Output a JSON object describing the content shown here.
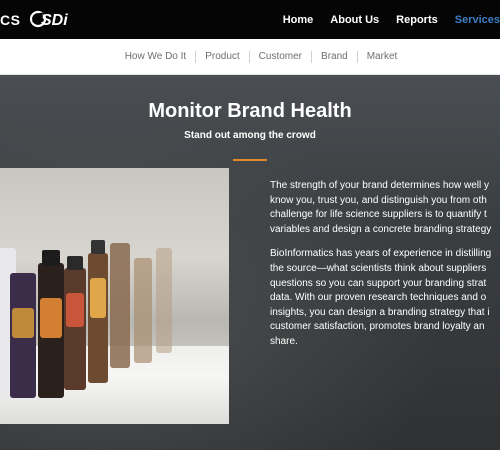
{
  "header": {
    "brand_fragment": "CS",
    "logo_text": "SDi",
    "nav": [
      {
        "label": "Home",
        "active": false
      },
      {
        "label": "About Us",
        "active": false
      },
      {
        "label": "Reports",
        "active": false
      },
      {
        "label": "Services",
        "active": true
      }
    ]
  },
  "subnav": {
    "items": [
      "How We Do It",
      "Product",
      "Customer",
      "Brand",
      "Market"
    ]
  },
  "hero": {
    "title": "Monitor Brand Health",
    "subtitle": "Stand out among the crowd",
    "accent_color": "#e0892b",
    "paragraph1_lines": [
      "The strength of your brand determines how well y",
      "know you, trust you, and distinguish you from oth",
      "challenge for life science suppliers is to quantify t",
      "variables and design a concrete branding strategy"
    ],
    "paragraph2_lines": [
      "BioInformatics has years of experience in distilling",
      "the source—what scientists think about suppliers",
      "questions so you can support your branding strat",
      "data. With our proven research techniques and o",
      "insights, you can design a branding strategy that i",
      "customer satisfaction, promotes brand loyalty an",
      "share."
    ]
  }
}
